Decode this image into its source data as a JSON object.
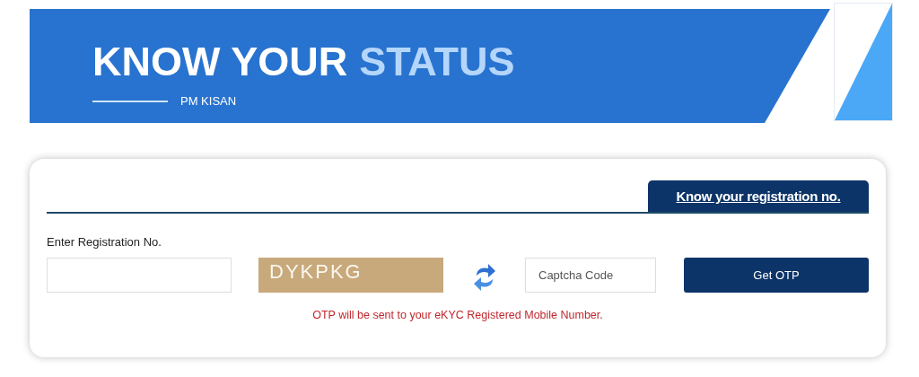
{
  "banner": {
    "title": [
      {
        "text": "KNOW YOUR",
        "highlight": false
      },
      {
        "text": "STATUS",
        "highlight": true
      }
    ],
    "subtitle": "PM KISAN"
  },
  "form": {
    "link_button": "Know your registration no.",
    "field_label": "Enter Registration No.",
    "captcha": "DYKPKG",
    "captcha_field": {
      "placeholder": "Captcha Code"
    },
    "submit_button": "Get OTP",
    "notice": "OTP will be sent to your eKYC Registered Mobile Number."
  }
}
